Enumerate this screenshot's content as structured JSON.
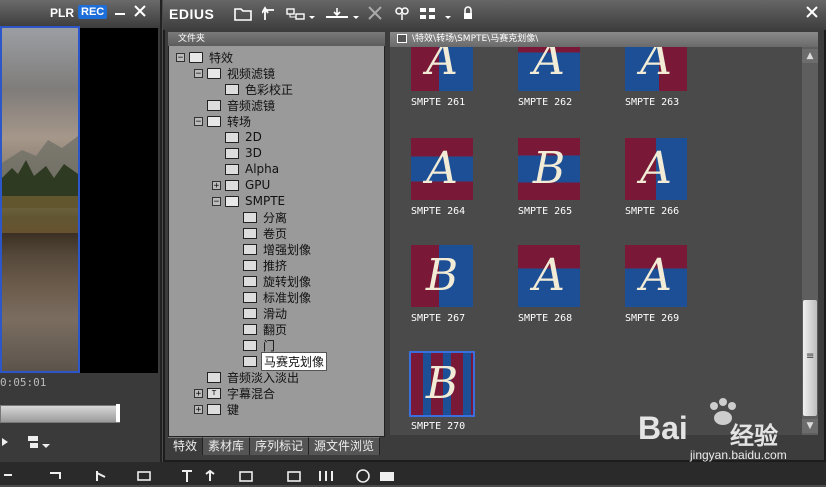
{
  "player": {
    "plr": "PLR",
    "rec": "REC",
    "timecode": "0:05:01",
    "minimize_icon": "minus-icon",
    "close_icon": "close-icon"
  },
  "effect_panel": {
    "app_name": "EDIUS",
    "tree_header": "文件夹",
    "path": "\\特效\\转场\\SMPTE\\马赛克划像\\",
    "tree": [
      {
        "label": "特效",
        "level": 0,
        "expander": "−",
        "icon": "folder-open-icon"
      },
      {
        "label": "视频滤镜",
        "level": 1,
        "expander": "−",
        "icon": "folder-open-icon"
      },
      {
        "label": "色彩校正",
        "level": 2,
        "expander": "",
        "icon": "effect-icon"
      },
      {
        "label": "音频滤镜",
        "level": 1,
        "expander": "",
        "icon": "effect-icon"
      },
      {
        "label": "转场",
        "level": 1,
        "expander": "−",
        "icon": "folder-open-icon"
      },
      {
        "label": "2D",
        "level": 2,
        "expander": "",
        "icon": "effect-icon"
      },
      {
        "label": "3D",
        "level": 2,
        "expander": "",
        "icon": "effect-icon"
      },
      {
        "label": "Alpha",
        "level": 2,
        "expander": "",
        "icon": "effect-icon"
      },
      {
        "label": "GPU",
        "level": 2,
        "expander": "+",
        "icon": "effect-icon"
      },
      {
        "label": "SMPTE",
        "level": 2,
        "expander": "−",
        "icon": "folder-open-icon"
      },
      {
        "label": "分离",
        "level": 3,
        "expander": "",
        "icon": "effect-icon"
      },
      {
        "label": "卷页",
        "level": 3,
        "expander": "",
        "icon": "effect-icon"
      },
      {
        "label": "增强划像",
        "level": 3,
        "expander": "",
        "icon": "effect-icon"
      },
      {
        "label": "推挤",
        "level": 3,
        "expander": "",
        "icon": "effect-icon"
      },
      {
        "label": "旋转划像",
        "level": 3,
        "expander": "",
        "icon": "effect-icon"
      },
      {
        "label": "标准划像",
        "level": 3,
        "expander": "",
        "icon": "effect-icon"
      },
      {
        "label": "滑动",
        "level": 3,
        "expander": "",
        "icon": "effect-icon"
      },
      {
        "label": "翻页",
        "level": 3,
        "expander": "",
        "icon": "effect-icon"
      },
      {
        "label": "门",
        "level": 3,
        "expander": "",
        "icon": "effect-icon"
      },
      {
        "label": "马赛克划像",
        "level": 3,
        "expander": "",
        "icon": "effect-icon",
        "selected": true
      },
      {
        "label": "音频淡入淡出",
        "level": 1,
        "expander": "",
        "icon": "effect-icon"
      },
      {
        "label": "字幕混合",
        "level": 1,
        "expander": "+",
        "icon": "title-icon"
      },
      {
        "label": "键",
        "level": 1,
        "expander": "+",
        "icon": "effect-icon"
      }
    ],
    "tabs": [
      {
        "label": "特效",
        "active": true
      },
      {
        "label": "素材库"
      },
      {
        "label": "序列标记"
      },
      {
        "label": "源文件浏览"
      }
    ],
    "grid_items": [
      {
        "caption": "SMPTE  261",
        "letter": "A",
        "pattern": "left",
        "top_clip": true
      },
      {
        "caption": "SMPTE  262",
        "letter": "A",
        "pattern": "top",
        "top_clip": true
      },
      {
        "caption": "SMPTE  263",
        "letter": "A",
        "pattern": "right",
        "top_clip": true
      },
      {
        "caption": "SMPTE  264",
        "letter": "A",
        "pattern": "band"
      },
      {
        "caption": "SMPTE  265",
        "letter": "B",
        "pattern": "band2"
      },
      {
        "caption": "SMPTE  266",
        "letter": "A",
        "pattern": "split"
      },
      {
        "caption": "SMPTE  267",
        "letter": "B",
        "pattern": "left"
      },
      {
        "caption": "SMPTE  268",
        "letter": "A",
        "pattern": "top"
      },
      {
        "caption": "SMPTE  269",
        "letter": "A",
        "pattern": "top"
      },
      {
        "caption": "SMPTE  270",
        "letter": "B",
        "pattern": "mosaic",
        "selected": true
      }
    ],
    "colors": {
      "blue": "#1d4f96",
      "crimson": "#7a1838",
      "select": "#3b6fe0"
    }
  },
  "watermark": {
    "logo": "Bai",
    "logo_cn": "经验",
    "url": "jingyan.baidu.com",
    "paw_icon": "paw-icon"
  }
}
